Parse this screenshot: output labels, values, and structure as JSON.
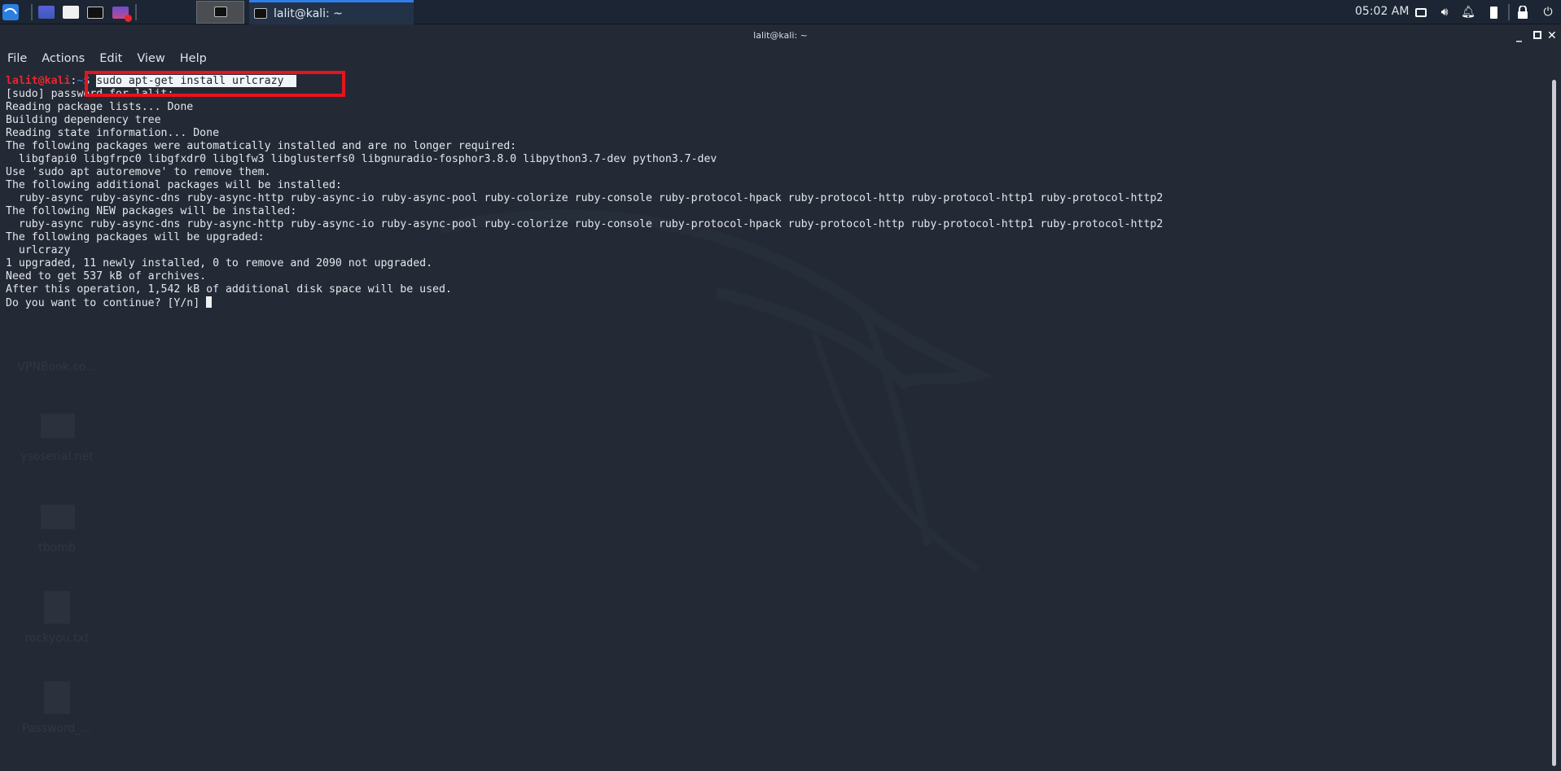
{
  "panel": {
    "task_label": "lalit@kali: ~",
    "clock": "05:02 AM",
    "icons": [
      "kali-menu-icon",
      "workspace-icon",
      "files-icon",
      "terminal-icon",
      "screen-recorder-icon",
      "display-icon",
      "volume-icon",
      "notification-bell-icon",
      "battery-icon",
      "lock-icon",
      "logout-icon"
    ]
  },
  "window": {
    "title": "lalit@kali: ~",
    "menu": [
      "File",
      "Actions",
      "Edit",
      "View",
      "Help"
    ]
  },
  "desktop": [
    "VPNBook.co...",
    "ysoserial.net",
    "tbomb",
    "rockyou.txt",
    "Password_..."
  ],
  "terminal": {
    "prompt_user": "lalit@kali",
    "prompt_sep": ":",
    "prompt_dir": "~",
    "prompt_symbol": "$",
    "command": "sudo apt-get install urlcrazy",
    "lines": [
      "[sudo] password for lalit:",
      "Reading package lists... Done",
      "Building dependency tree",
      "Reading state information... Done",
      "The following packages were automatically installed and are no longer required:",
      "  libgfapi0 libgfrpc0 libgfxdr0 libglfw3 libglusterfs0 libgnuradio-fosphor3.8.0 libpython3.7-dev python3.7-dev",
      "Use 'sudo apt autoremove' to remove them.",
      "The following additional packages will be installed:",
      "  ruby-async ruby-async-dns ruby-async-http ruby-async-io ruby-async-pool ruby-colorize ruby-console ruby-protocol-hpack ruby-protocol-http ruby-protocol-http1 ruby-protocol-http2",
      "The following NEW packages will be installed:",
      "  ruby-async ruby-async-dns ruby-async-http ruby-async-io ruby-async-pool ruby-colorize ruby-console ruby-protocol-hpack ruby-protocol-http ruby-protocol-http1 ruby-protocol-http2",
      "The following packages will be upgraded:",
      "  urlcrazy",
      "1 upgraded, 11 newly installed, 0 to remove and 2090 not upgraded.",
      "Need to get 537 kB of archives.",
      "After this operation, 1,542 kB of additional disk space will be used."
    ],
    "last_line": "Do you want to continue? [Y/n] "
  },
  "colors": {
    "highlight_box": "#e8131c",
    "prompt_user": "#e8262e",
    "accent": "#2f7fe8"
  }
}
